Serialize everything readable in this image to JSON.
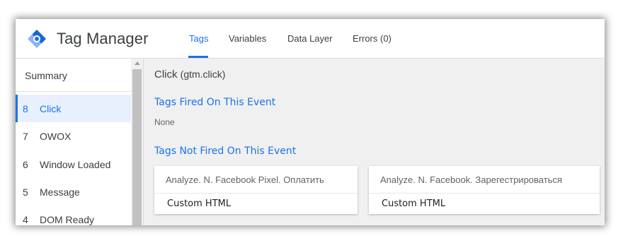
{
  "header": {
    "app_title": "Tag Manager",
    "tabs": [
      {
        "label": "Tags",
        "active": true
      },
      {
        "label": "Variables",
        "active": false
      },
      {
        "label": "Data Layer",
        "active": false
      },
      {
        "label": "Errors (0)",
        "active": false
      }
    ]
  },
  "sidebar": {
    "summary_label": "Summary",
    "events": [
      {
        "num": "8",
        "label": "Click",
        "selected": true
      },
      {
        "num": "7",
        "label": "OWOX",
        "selected": false
      },
      {
        "num": "6",
        "label": "Window Loaded",
        "selected": false
      },
      {
        "num": "5",
        "label": "Message",
        "selected": false
      },
      {
        "num": "4",
        "label": "DOM Ready",
        "selected": false
      }
    ]
  },
  "main": {
    "event_name": "Click",
    "event_key": "(gtm.click)",
    "fired_title": "Tags Fired On This Event",
    "fired_none": "None",
    "not_fired_title": "Tags Not Fired On This Event",
    "not_fired_tags": [
      {
        "name": "Analyze. N. Facebook Pixel. Оплатить",
        "type": "Custom HTML"
      },
      {
        "name": "Analyze. N. Facebook. Зарегестрироваться",
        "type": "Custom HTML"
      }
    ]
  },
  "colors": {
    "accent": "#1a73e8",
    "logo_light": "#8ab4f8",
    "logo_dark": "#1967d2",
    "main_bg": "#f0f0f0"
  }
}
